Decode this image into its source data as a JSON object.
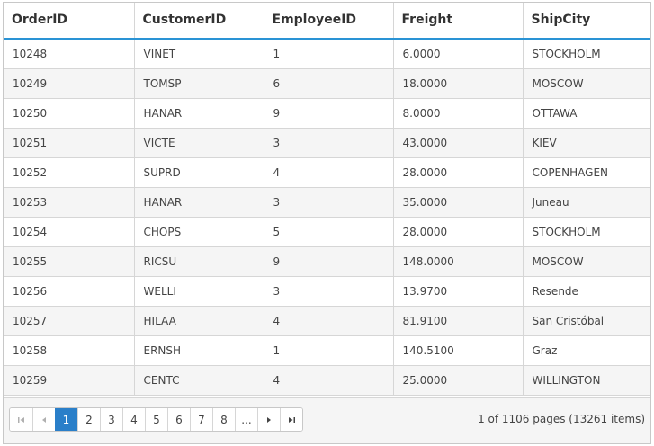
{
  "grid": {
    "columns": [
      "OrderID",
      "CustomerID",
      "EmployeeID",
      "Freight",
      "ShipCity"
    ],
    "rows": [
      [
        "10248",
        "VINET",
        "1",
        "6.0000",
        "STOCKHOLM"
      ],
      [
        "10249",
        "TOMSP",
        "6",
        "18.0000",
        "MOSCOW"
      ],
      [
        "10250",
        "HANAR",
        "9",
        "8.0000",
        "OTTAWA"
      ],
      [
        "10251",
        "VICTE",
        "3",
        "43.0000",
        "KIEV"
      ],
      [
        "10252",
        "SUPRD",
        "4",
        "28.0000",
        "COPENHAGEN"
      ],
      [
        "10253",
        "HANAR",
        "3",
        "35.0000",
        "Juneau"
      ],
      [
        "10254",
        "CHOPS",
        "5",
        "28.0000",
        "STOCKHOLM"
      ],
      [
        "10255",
        "RICSU",
        "9",
        "148.0000",
        "MOSCOW"
      ],
      [
        "10256",
        "WELLI",
        "3",
        "13.9700",
        "Resende"
      ],
      [
        "10257",
        "HILAA",
        "4",
        "81.9100",
        "San Cristóbal"
      ],
      [
        "10258",
        "ERNSH",
        "1",
        "140.5100",
        "Graz"
      ],
      [
        "10259",
        "CENTC",
        "4",
        "25.0000",
        "WILLINGTON"
      ]
    ]
  },
  "pager": {
    "first_icon": "first-page-icon",
    "prev_icon": "previous-page-icon",
    "pages": [
      "1",
      "2",
      "3",
      "4",
      "5",
      "6",
      "7",
      "8",
      "..."
    ],
    "current_page": "1",
    "next_icon": "next-page-icon",
    "last_icon": "last-page-icon",
    "info": "1 of 1106 pages (13261 items)"
  },
  "colors": {
    "header_underline": "#2a93d5",
    "active_page": "#2a7fc9",
    "alt_row": "#f5f5f5"
  }
}
